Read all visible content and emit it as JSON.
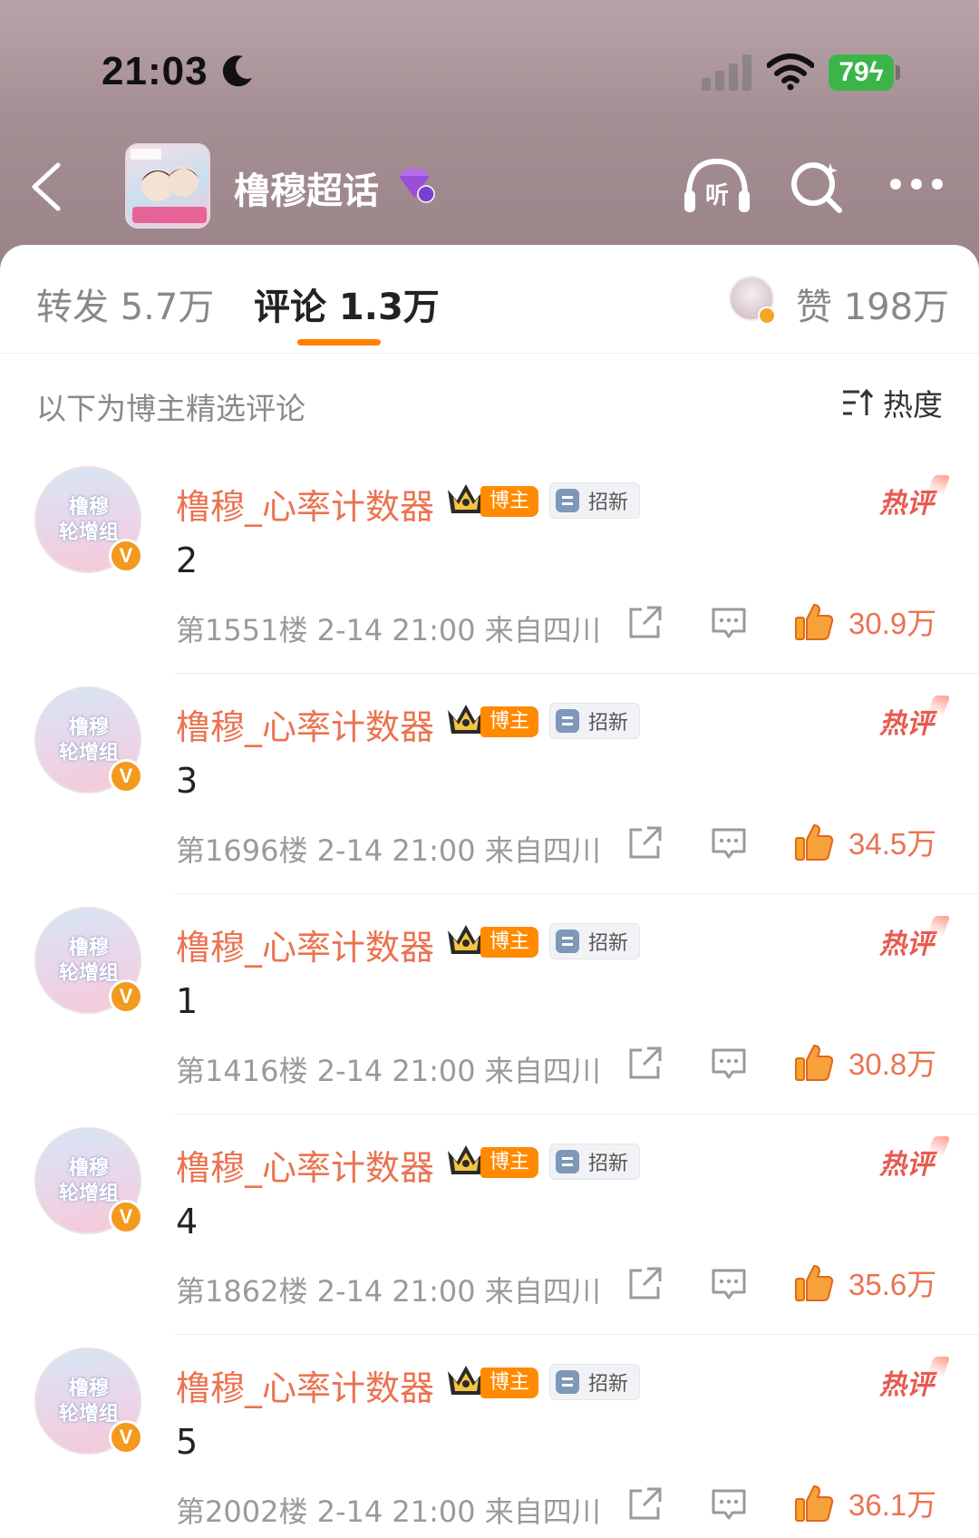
{
  "status_bar": {
    "time": "21:03",
    "battery": "79"
  },
  "nav": {
    "title": "橹穆超话"
  },
  "tabs": {
    "repost": "转发 5.7万",
    "comment": "评论 1.3万",
    "likes": "赞 198万"
  },
  "filter": {
    "label": "以下为博主精选评论",
    "sort": "热度"
  },
  "badges": {
    "owner": "博主",
    "recruit": "招新",
    "hot": "热评",
    "verified": "V"
  },
  "avatar_text": "橹穆\n轮增组",
  "comments": [
    {
      "user": "橹穆_心率计数器",
      "text": "2",
      "meta": "第1551楼 2-14 21:00 来自四川",
      "likes": "30.9万"
    },
    {
      "user": "橹穆_心率计数器",
      "text": "3",
      "meta": "第1696楼 2-14 21:00 来自四川",
      "likes": "34.5万"
    },
    {
      "user": "橹穆_心率计数器",
      "text": "1",
      "meta": "第1416楼 2-14 21:00 来自四川",
      "likes": "30.8万"
    },
    {
      "user": "橹穆_心率计数器",
      "text": "4",
      "meta": "第1862楼 2-14 21:00 来自四川",
      "likes": "35.6万"
    },
    {
      "user": "橹穆_心率计数器",
      "text": "5",
      "meta": "第2002楼 2-14 21:00 来自四川",
      "likes": "36.1万"
    }
  ],
  "colors": {
    "accent": "#ff8200",
    "username": "#eb7350",
    "hot": "#e85a4f",
    "header": "#a48e93"
  }
}
